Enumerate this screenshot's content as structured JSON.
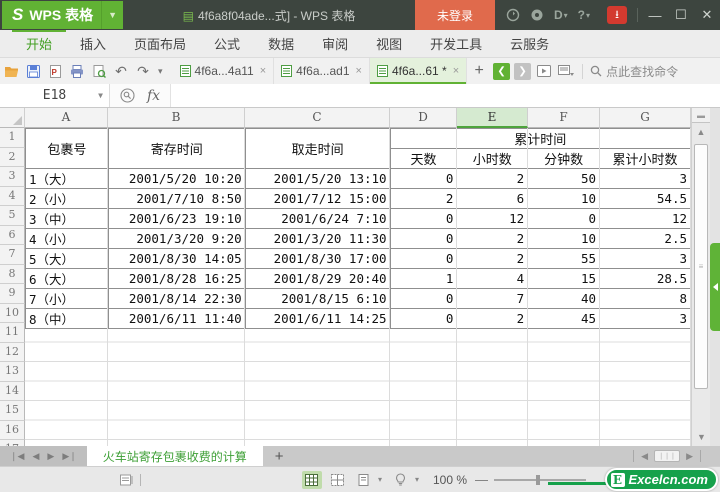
{
  "window": {
    "app_button": "WPS 表格",
    "app_logo": "S",
    "title": "4f6a8f04ade...式] - WPS 表格",
    "login_button": "未登录",
    "minimize": "—",
    "maximize": "❐",
    "close": "✕"
  },
  "menu": {
    "items": [
      "开始",
      "插入",
      "页面布局",
      "公式",
      "数据",
      "审阅",
      "视图",
      "开发工具",
      "云服务"
    ],
    "active_index": 0
  },
  "doc_tabs": [
    {
      "label": "4f6a...4a11",
      "close": "×",
      "active": false
    },
    {
      "label": "4f6a...ad1",
      "close": "×",
      "active": false
    },
    {
      "label": "4f6a...61 *",
      "close": "×",
      "active": true
    }
  ],
  "toolbar": {
    "add_tab": "+",
    "prev": "❮",
    "next": "❯",
    "search_hint": "点此查找命令"
  },
  "formula_bar": {
    "name_box": "E18",
    "fx_label": "fx",
    "formula_value": ""
  },
  "sheet": {
    "selected_cell": "E18",
    "columns": [
      "A",
      "B",
      "C",
      "D",
      "E",
      "F",
      "G"
    ],
    "selected_column": "E",
    "visible_row_count": 17,
    "table": {
      "header": {
        "package": "包裹号",
        "store_time": "寄存时间",
        "pickup_time": "取走时间",
        "cumulative_group": "累计时间",
        "days": "天数",
        "hours": "小时数",
        "minutes": "分钟数",
        "total_hours": "累计小时数"
      },
      "rows": [
        [
          "1（大）",
          "2001/5/20 10:20",
          "2001/5/20 13:10",
          "0",
          "2",
          "50",
          "3"
        ],
        [
          "2（小）",
          "2001/7/10 8:50",
          "2001/7/12 15:00",
          "2",
          "6",
          "10",
          "54.5"
        ],
        [
          "3（中）",
          "2001/6/23 19:10",
          "2001/6/24 7:10",
          "0",
          "12",
          "0",
          "12"
        ],
        [
          "4（小）",
          "2001/3/20 9:20",
          "2001/3/20 11:30",
          "0",
          "2",
          "10",
          "2.5"
        ],
        [
          "5（大）",
          "2001/8/30 14:05",
          "2001/8/30 17:00",
          "0",
          "2",
          "55",
          "3"
        ],
        [
          "6（大）",
          "2001/8/28 16:25",
          "2001/8/29 20:40",
          "1",
          "4",
          "15",
          "28.5"
        ],
        [
          "7（小）",
          "2001/8/14 22:30",
          "2001/8/15 6:10",
          "0",
          "7",
          "40",
          "8"
        ],
        [
          "8（中）",
          "2001/6/11 11:40",
          "2001/6/11 14:25",
          "0",
          "2",
          "45",
          "3"
        ]
      ]
    }
  },
  "sheet_tabs": {
    "active": "火车站寄存包裹收费的计算",
    "add": "+"
  },
  "status_bar": {
    "zoom_level": "100 %",
    "zoom_minus": "—"
  },
  "watermark": {
    "icon": "E",
    "text": "Excelcn.com"
  },
  "colors": {
    "wps_green": "#61b234",
    "titlebar_dark": "#3d453f",
    "login_orange": "#e06a4c",
    "active_tab_green_bg": "#e4f1dc",
    "selected_col_bg": "#d5ead0",
    "watermark_green": "#16a14b"
  }
}
